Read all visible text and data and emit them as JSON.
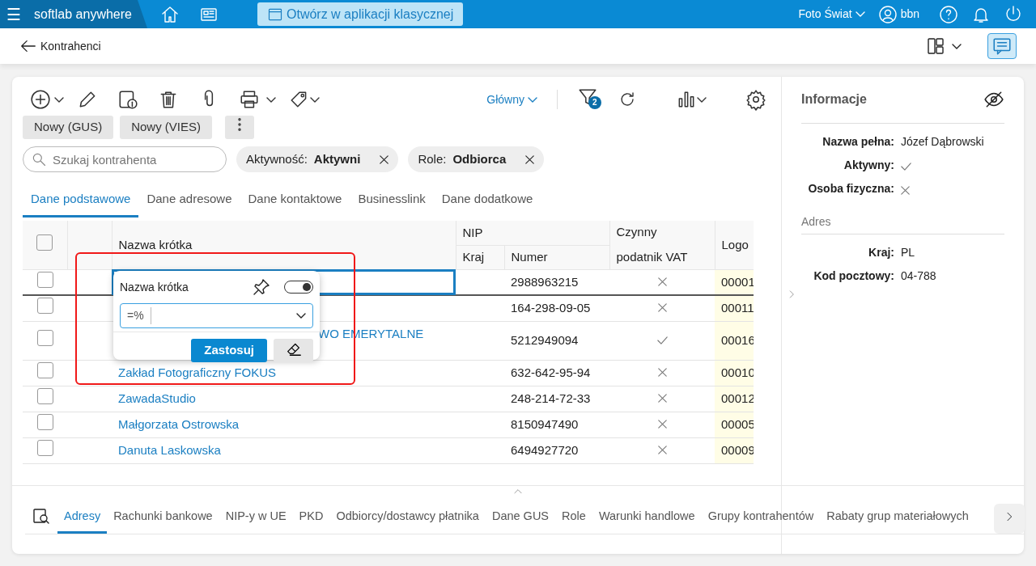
{
  "topbar": {
    "menu": "☰",
    "brand": "softlab anywhere",
    "classic_button": "Otwórz w aplikacji klasycznej",
    "company": "Foto Świat",
    "user": "bbn"
  },
  "header": {
    "title": "Kontrahenci"
  },
  "toolbar": {
    "buttons": [
      "Nowy (GUS)",
      "Nowy (VIES)"
    ],
    "view": "Główny",
    "filter_count": "2"
  },
  "search": {
    "placeholder": "Szukaj kontrahenta"
  },
  "filters": [
    {
      "label": "Aktywność:",
      "value": "Aktywni"
    },
    {
      "label": "Role:",
      "value": "Odbiorca"
    }
  ],
  "tabs": [
    {
      "label": "Dane podstawowe",
      "selected": true
    },
    {
      "label": "Dane adresowe",
      "selected": false
    },
    {
      "label": "Dane kontaktowe",
      "selected": false
    },
    {
      "label": "Businesslink",
      "selected": false
    },
    {
      "label": "Dane dodatkowe",
      "selected": false
    }
  ],
  "table": {
    "select_all_checked": false,
    "columns": {
      "name": "Nazwa krótka",
      "nip": "NIP",
      "country": "Kraj",
      "number": "Numer",
      "vat": [
        "Czynny",
        "podatnik VAT"
      ],
      "logo": "Logo"
    },
    "rows": [
      {
        "number": "2988963215",
        "vat_active": false,
        "logo": "00001",
        "selected": true,
        "checked": false
      },
      {
        "number": "164-298-09-05",
        "vat_active": false,
        "logo": "00011",
        "selected": false,
        "checked": false
      },
      {
        "name": "WO EMERYTALNE",
        "partial": true,
        "number": "5212949094",
        "vat_active": true,
        "logo": "00016",
        "selected": false,
        "checked": false
      },
      {
        "name": "Zakład Fotograficzny FOKUS",
        "number": "632-642-95-94",
        "vat_active": false,
        "logo": "00010",
        "selected": false,
        "checked": false
      },
      {
        "name": "ZawadaStudio",
        "number": "248-214-72-33",
        "vat_active": false,
        "logo": "00012",
        "selected": false,
        "checked": false
      },
      {
        "name": "Małgorzata Ostrowska",
        "number": "8150947490",
        "vat_active": false,
        "logo": "00005",
        "selected": false,
        "checked": false
      },
      {
        "name": "Danuta Laskowska",
        "number": "6494927720",
        "vat_active": false,
        "logo": "00009",
        "selected": false,
        "checked": false
      }
    ]
  },
  "filter_popup": {
    "title": "Nazwa krótka",
    "pinned_toggle": true,
    "operator": "=%",
    "apply": "Zastosuj"
  },
  "info": {
    "title": "Informacje",
    "fields": [
      {
        "label": "Nazwa pełna:",
        "kind": "text",
        "value": "Józef Dąbrowski"
      },
      {
        "label": "Aktywny:",
        "kind": "flag",
        "on": true
      },
      {
        "label": "Osoba fizyczna:",
        "kind": "flag",
        "on": false
      }
    ],
    "address_title": "Adres",
    "address": [
      {
        "label": "Kraj:",
        "value": "PL"
      },
      {
        "label": "Kod pocztowy:",
        "value": "04-788"
      }
    ]
  },
  "bottom_tabs": [
    {
      "label": "Adresy",
      "selected": true
    },
    {
      "label": "Rachunki bankowe",
      "selected": false
    },
    {
      "label": "NIP-y w UE",
      "selected": false
    },
    {
      "label": "PKD",
      "selected": false
    },
    {
      "label": "Odbiorcy/dostawcy płatnika",
      "selected": false
    },
    {
      "label": "Dane GUS",
      "selected": false
    },
    {
      "label": "Role",
      "selected": false
    },
    {
      "label": "Warunki handlowe",
      "selected": false
    },
    {
      "label": "Grupy kontrahentów",
      "selected": false
    },
    {
      "label": "Rabaty grup materiałowych",
      "selected": false
    }
  ]
}
